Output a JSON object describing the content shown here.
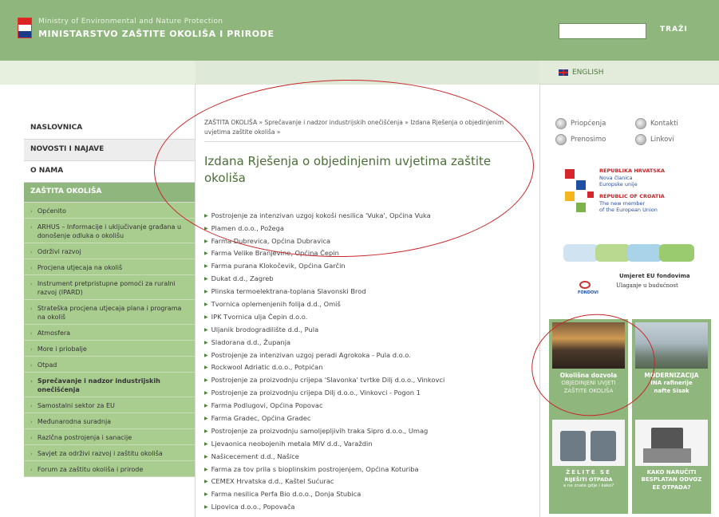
{
  "header": {
    "ministry_en": "Ministry of Environmental and Nature Protection",
    "ministry_hr": "MINISTARSTVO ZAŠTITE OKOLIŠA I PRIRODE",
    "search_placeholder": "",
    "search_button": "TRAŽI"
  },
  "subheader": {
    "english_link": "ENGLISH"
  },
  "nav": {
    "main": [
      "NASLOVNICA",
      "NOVOSTI I NAJAVE",
      "O NAMA",
      "ZAŠTITA OKOLIŠA"
    ],
    "sub": [
      "Općenito",
      "ARHUS – Informacije i uključivanje građana u donošenje odluka o okolišu",
      "Održivi razvoj",
      "Procjena utjecaja na okoliš",
      "Instrument pretpristupne pomoći za ruralni razvoj (IPARD)",
      "Strateška procjena utjecaja plana i programa na okoliš",
      "Atmosfera",
      "More i priobalje",
      "Otpad",
      "Sprečavanje i nadzor industrijskih onečišćenja",
      "Samostalni sektor za EU",
      "Međunarodna suradnja",
      "Razlčna postrojenja i sanacije",
      "Savjet za održivi razvoj i zaštitu okoliša",
      "Forum za zaštitu okoliša i prirode"
    ]
  },
  "breadcrumb": {
    "item1": "ZAŠTITA OKOLIŠA",
    "sep1": "»",
    "item2": "Sprečavanje i nadzor industrijskih onečišćenja",
    "sep2": "»",
    "item3": "Izdana Rješenja o objedinjenim uvjetima zaštite okoliša",
    "sep3": "»"
  },
  "page_title": "Izdana Rješenja o objedinjenim uvjetima zaštite okoliša",
  "companies": [
    "Postrojenje za intenzivan uzgoj kokoši nesilica 'Vuka', Općina Vuka",
    "Plamen d.o.o., Požega",
    "Farma Dubrevica, Općina Dubravica",
    "Farma Velike Branjevine, Općina Čepin",
    "Farma purana Klokočevik, Općina Garčin",
    "Dukat d.d., Zagreb",
    "Plinska termoelektrana-toplana Slavonski Brod",
    "Tvornica oplemenjenih folija d.d., Omiš",
    "IPK Tvornica ulja Čepin d.o.o.",
    "Uljanik brodogradilište d.d., Pula",
    "Sladorana d.d., Županja",
    "Postrojenje za intenzivan uzgoj peradi Agrokoka - Pula d.o.o.",
    "Rockwool Adriatic d.o.o., Potpićan",
    "Postrojenje za proizvodnju crijepa 'Slavonka' tvrtke Dilj d.o.o., Vinkovci",
    "Postrojenje za proizvodnju crijepa Dilj d.o.o., Vinkovci - Pogon 1",
    "Farma Podlugovi, Općina Popovac",
    "Farma Gradec, Općina Gradec",
    "Postrojenje za proizvodnju samoljepljivih traka Sipro d.o.o., Umag",
    "Ljevaonica neobojenih metala MIV d.d., Varaždin",
    "Našicecement d.d., Našice",
    "Farma za tov prila s bioplinskim postrojenjem, Općina Koturiba",
    "CEMEX Hrvatska d.d., Kaštel Sućurac",
    "Farma nesilica Perfa Bio d.o.o., Donja Stubica",
    "Lipovica d.o.o., Popovača"
  ],
  "quick_links": [
    "Priopćenja",
    "Kontakti",
    "Prenosimo",
    "Linkovi"
  ],
  "eu_banner": {
    "hr_title": "REPUBLIKA HRVATSKA",
    "hr_sub1": "Nova članica",
    "hr_sub2": "Europske unije",
    "en_title": "REPUBLIC OF CROATIA",
    "en_sub1": "The new member",
    "en_sub2": "of the European Union"
  },
  "fund_banner": {
    "line1": "Umjeret EU fondovima",
    "line2": "Ulaganje u budućnost",
    "logo": "FONDOVI"
  },
  "tiles": [
    {
      "line1": "Okolišna dozvola",
      "line2": "OBJEDINJENI UVJETI",
      "line3": "ZAŠTITE OKOLIŠA"
    },
    {
      "line1": "MODERNIZACIJA",
      "line2": "INA rafinerije",
      "line3": "nafte Sisak"
    },
    {
      "line1": "ŽELITE SE",
      "line2": "RIJEŠITI OTPADA",
      "line3": "a ne znate gdje i kako?"
    },
    {
      "line1": "KAKO NARUČITI",
      "line2": "BESPLATAN ODVOZ",
      "line3": "EE OTPADA?"
    }
  ],
  "colors": {
    "header_green": "#8fb77d",
    "nav_active": "#8fb77d",
    "nav_sub_bg": "#a9cc8f",
    "title_green": "#4a6e37",
    "annotation_red": "#c8272a"
  }
}
